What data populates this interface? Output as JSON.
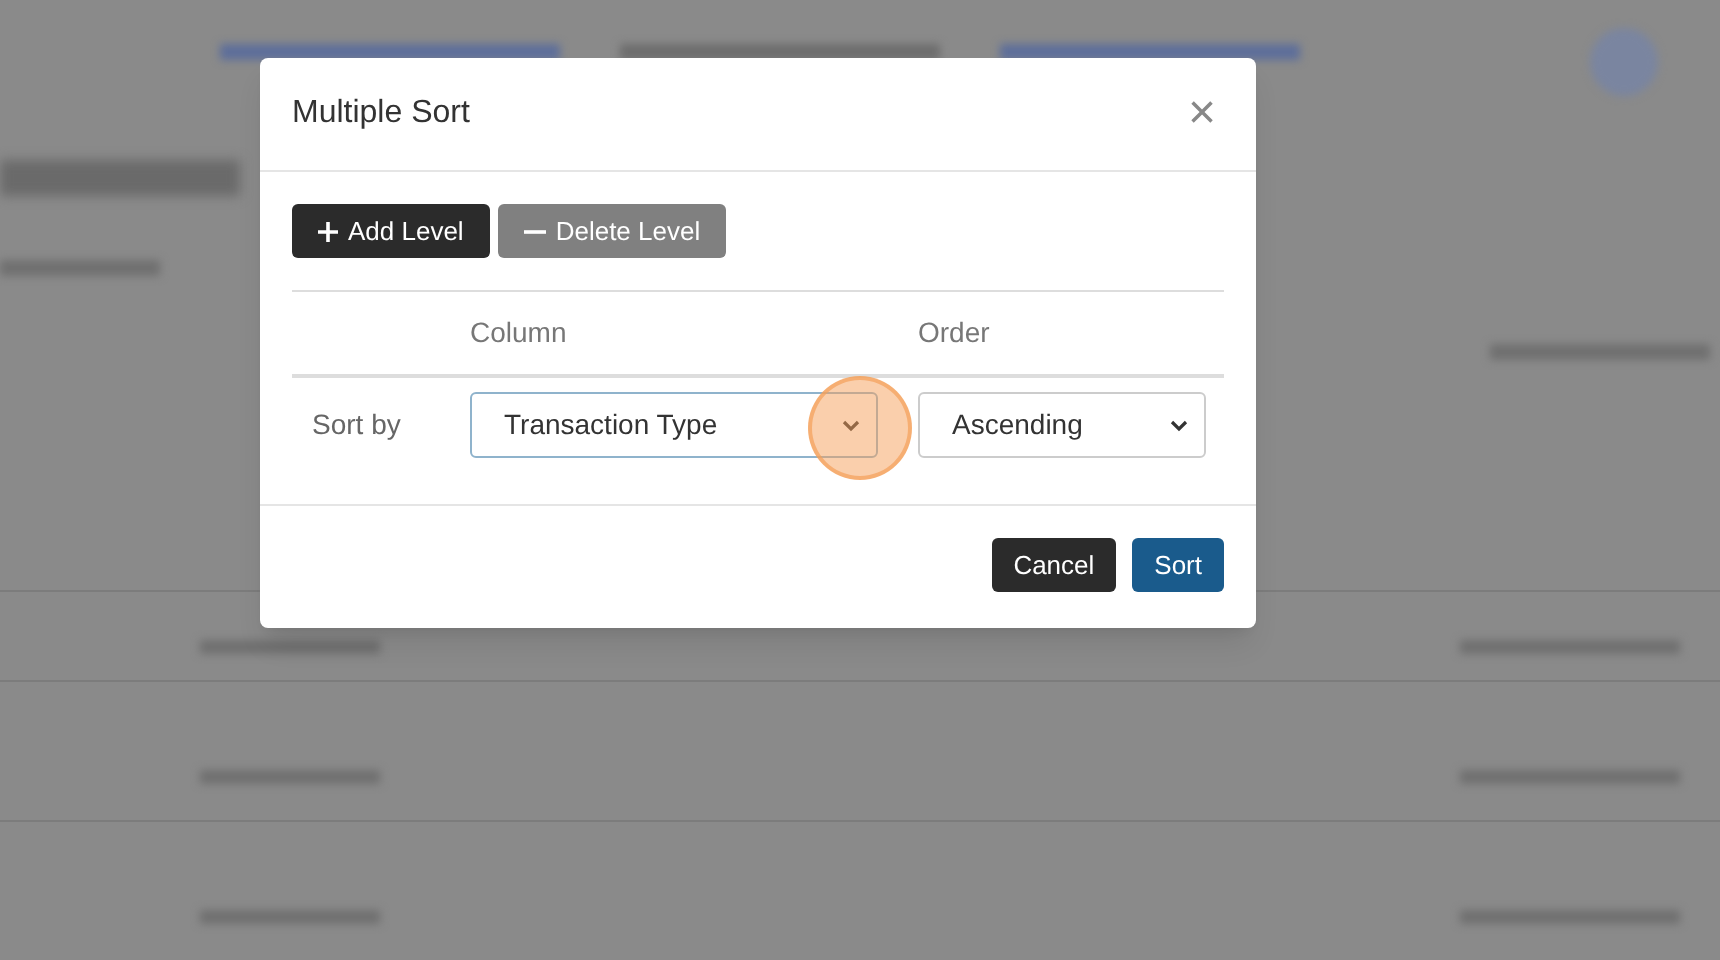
{
  "dialog": {
    "title": "Multiple Sort",
    "close_icon": "×",
    "toolbar": [
      {
        "kind": "add",
        "label": "Add Level"
      },
      {
        "kind": "delete",
        "label": "Delete Level"
      }
    ],
    "columns": [
      "Column",
      "Order"
    ],
    "levels": [
      {
        "label": "Sort by",
        "column": {
          "value": "Transaction Type",
          "focused": true
        },
        "order": {
          "value": "Ascending",
          "focused": false
        }
      }
    ],
    "buttons": [
      {
        "kind": "cancel",
        "label": "Cancel"
      },
      {
        "kind": "primary",
        "label": "Sort"
      }
    ]
  }
}
